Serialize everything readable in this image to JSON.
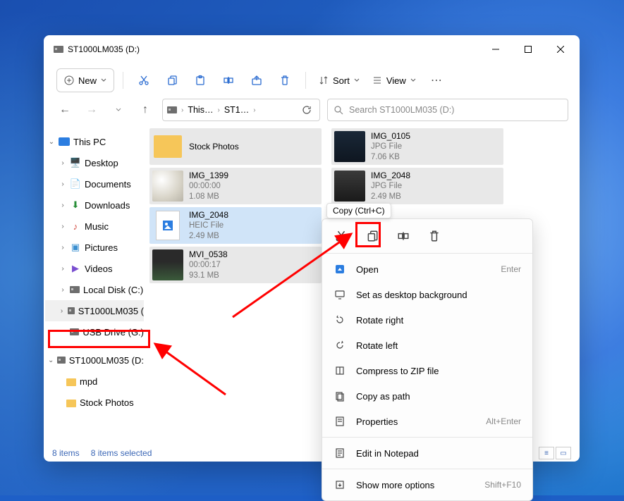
{
  "window": {
    "title": "ST1000LM035 (D:)"
  },
  "toolbar": {
    "new": "New",
    "sort": "Sort",
    "view": "View"
  },
  "breadcrumb": {
    "seg1": "This…",
    "seg2": "ST1…"
  },
  "search": {
    "placeholder": "Search ST1000LM035 (D:)"
  },
  "sidebar": {
    "thisPC": "This PC",
    "desktop": "Desktop",
    "documents": "Documents",
    "downloads": "Downloads",
    "music": "Music",
    "pictures": "Pictures",
    "videos": "Videos",
    "localDisk": "Local Disk (C:)",
    "st1000": "ST1000LM035 (",
    "usb": "USB Drive (G:)",
    "st1000_2": "ST1000LM035 (D:",
    "mpd": "mpd",
    "stockPhotos": "Stock Photos"
  },
  "files": [
    {
      "name": "Stock Photos",
      "meta1": "",
      "meta2": ""
    },
    {
      "name": "IMG_0105",
      "meta1": "JPG File",
      "meta2": "7.06 KB"
    },
    {
      "name": "IMG_1399",
      "meta1": "00:00:00",
      "meta2": "1.08 MB"
    },
    {
      "name": "IMG_2048",
      "meta1": "JPG File",
      "meta2": "2.49 MB"
    },
    {
      "name": "IMG_2048",
      "meta1": "HEIC File",
      "meta2": "2.49 MB"
    },
    {
      "name": "MVI_0538",
      "meta1": "00:00:17",
      "meta2": "93.1 MB"
    }
  ],
  "tooltip": "Copy (Ctrl+C)",
  "contextMenu": {
    "open": "Open",
    "openSc": "Enter",
    "setBg": "Set as desktop background",
    "rotateR": "Rotate right",
    "rotateL": "Rotate left",
    "compress": "Compress to ZIP file",
    "copyPath": "Copy as path",
    "properties": "Properties",
    "propSc": "Alt+Enter",
    "notepad": "Edit in Notepad",
    "more": "Show more options",
    "moreSc": "Shift+F10"
  },
  "status": {
    "count": "8 items",
    "selected": "8 items selected"
  }
}
